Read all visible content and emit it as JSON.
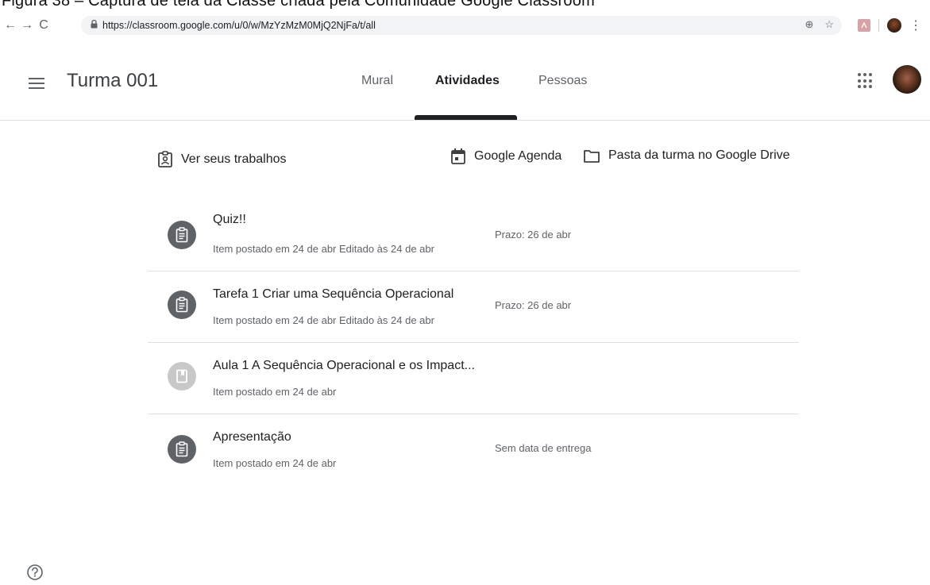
{
  "caption": "Figura 38 – Captura de tela da Classe criada pela Comunidade Google Classroom",
  "browser": {
    "back": "←",
    "forward": "→",
    "reload": "C",
    "url": "https://classroom.google.com/u/0/w/MzYzMzM0MjQ2NjFa/t/all",
    "zoom_icon": "⊕",
    "star_icon": "☆",
    "menu_icon": "⋮"
  },
  "header": {
    "class_title": "Turma 001",
    "tabs": [
      {
        "label": "Mural"
      },
      {
        "label": "Atividades"
      },
      {
        "label": "Pessoas"
      }
    ],
    "active_tab": "Atividades"
  },
  "toolbar": {
    "view_work": "Ver seus trabalhos",
    "calendar": "Google Agenda",
    "drive_folder": "Pasta da turma no Google Drive"
  },
  "items": [
    {
      "title": "Quiz!!",
      "subtitle": "Item postado em 24 de abr Editado às 24 de abr",
      "due": "Prazo: 26 de abr",
      "icon": "assignment-icon"
    },
    {
      "title": "Tarefa 1 Criar uma Sequência Operacional",
      "subtitle": "Item postado em 24 de abr Editado às 24 de abr",
      "due": "Prazo: 26 de abr",
      "icon": "assignment-icon"
    },
    {
      "title": "Aula 1 A Sequência Operacional e os Impact...",
      "subtitle": "Item postado em 24 de abr",
      "due": "",
      "icon": "material-icon"
    },
    {
      "title": "Apresentação",
      "subtitle": "Item postado em 24 de abr",
      "due": "Sem data de entrega",
      "icon": "assignment-icon"
    }
  ],
  "colors": {
    "icon_dark": "#5f6368",
    "icon_light": "#c8c8c8",
    "active_tab": "#202124",
    "divider": "#e0e0e0"
  }
}
